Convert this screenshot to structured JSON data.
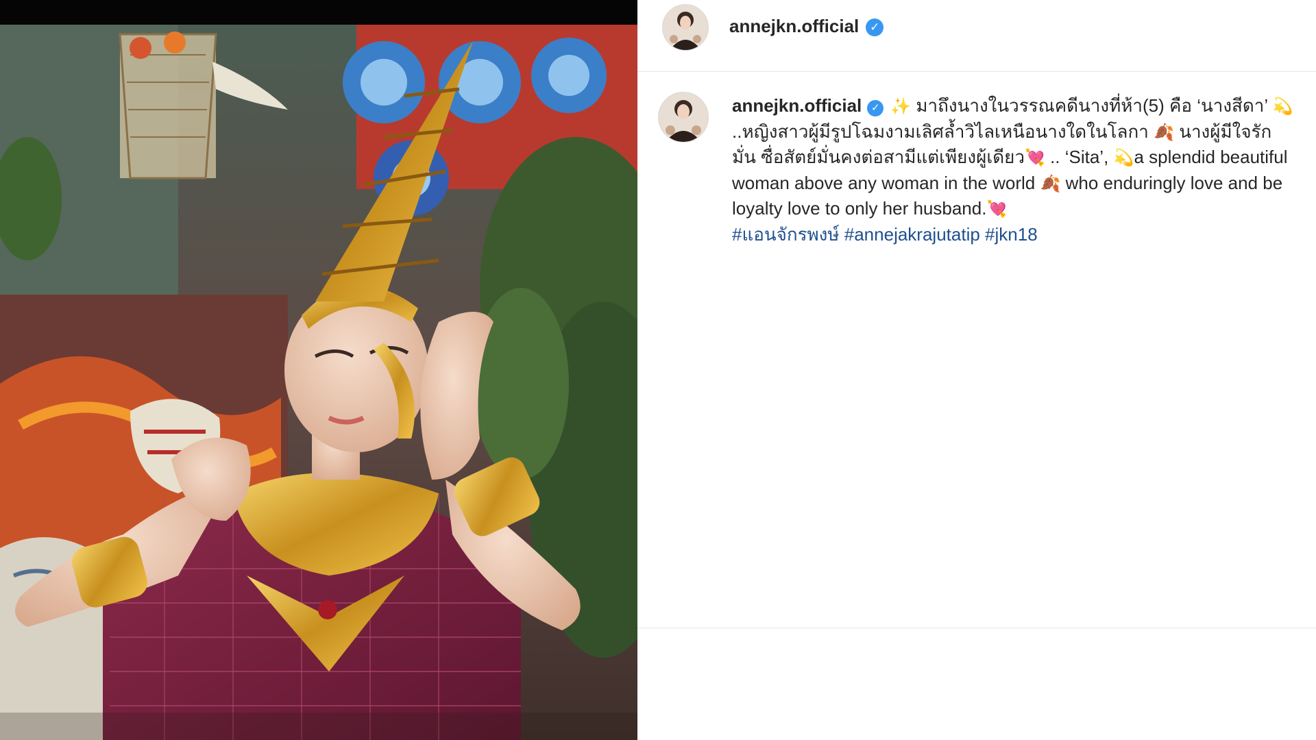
{
  "post": {
    "username": "annejkn.official",
    "verified_symbol": "✓",
    "caption": {
      "username": "annejkn.official",
      "emoji_sparkle": "✨",
      "thai_part1": "มาถึงนางในวรรณคดีนางที่ห้า(5) คือ ‘นางสีดา’",
      "emoji_dizzy": "💫",
      "thai_part2": "..หญิงสาวผู้มีรูปโฉมงามเลิศล้ำวิไลเหนือนางใดในโลกา",
      "emoji_leaf": "🍂",
      "thai_part3": "นางผู้มีใจรักมั่น ซื่อสัตย์มั่นคงต่อสามีแต่เพียงผู้เดียว",
      "emoji_heart": "💘",
      "en_part1": ".. ‘Sita’,",
      "en_part2": "a splendid beautiful woman above any woman in the world",
      "en_part3": "who enduringly love and be loyalty love to only her husband.",
      "hashtags": [
        "#แอนจักรพงษ์",
        "#annejakrajutatip",
        "#jkn18"
      ]
    }
  },
  "colors": {
    "verified_badge": "#3897f0",
    "hashtag": "#1f4f8f",
    "text": "#262626",
    "divider": "#e6e6e6"
  },
  "icons": {
    "verified": "verified-badge-icon"
  }
}
